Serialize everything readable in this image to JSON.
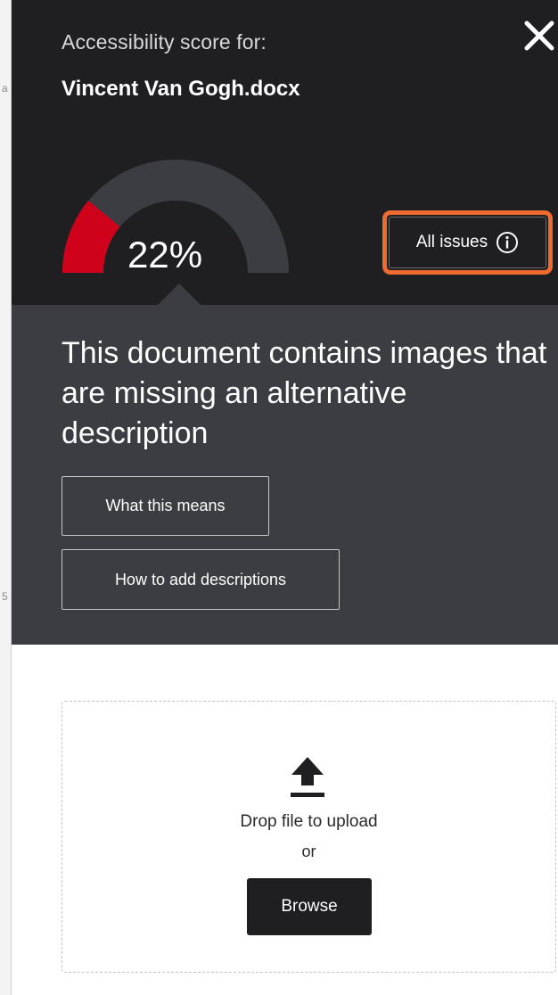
{
  "header": {
    "score_label": "Accessibility score for:",
    "file_name": "Vincent Van Gogh.docx",
    "close_icon": "close-icon"
  },
  "score": {
    "percent_label": "22%",
    "value": 0.22,
    "fill_color": "#d0021b",
    "track_color": "#3c3d42"
  },
  "all_issues": {
    "label": "All issues",
    "icon": "info-icon",
    "highlight_color": "#ef6a2f"
  },
  "issue": {
    "description": "This document contains images that are missing an alternative description",
    "buttons": {
      "what_this_means": "What this means",
      "how_to_add": "How to add descriptions"
    }
  },
  "upload": {
    "icon": "upload-icon",
    "drop_text": "Drop file to upload",
    "or_text": "or",
    "browse_label": "Browse"
  },
  "margin_marks": {
    "top": "a",
    "mid": "5"
  }
}
